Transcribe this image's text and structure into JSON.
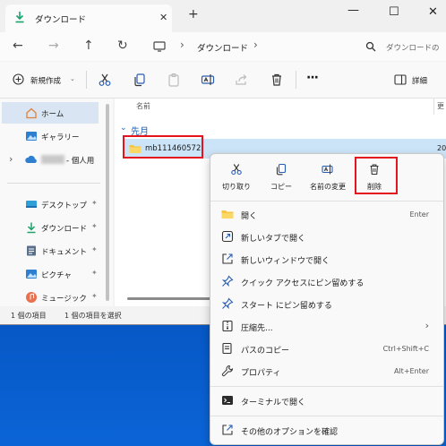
{
  "window": {
    "tab_title": "ダウンロード",
    "tab_close": "✕",
    "new_tab": "+",
    "minimize": "—",
    "maximize": "☐",
    "close": "✕"
  },
  "nav": {
    "back": "←",
    "forward": "→",
    "up": "↑",
    "refresh": "↻",
    "separator": "›",
    "breadcrumb": "ダウンロード",
    "search_placeholder": "ダウンロードの"
  },
  "toolbar": {
    "new_label": "新規作成",
    "details_label": "詳細",
    "more": "···"
  },
  "sidebar": {
    "items": [
      {
        "label": "ホーム",
        "icon": "home-icon"
      },
      {
        "label": "ギャラリー",
        "icon": "gallery-icon"
      },
      {
        "label": "- 個人用",
        "icon": "onedrive-icon"
      },
      {
        "label": "デスクトップ",
        "icon": "desktop-folder-icon"
      },
      {
        "label": "ダウンロード",
        "icon": "download-icon"
      },
      {
        "label": "ドキュメント",
        "icon": "documents-icon"
      },
      {
        "label": "ピクチャ",
        "icon": "pictures-icon"
      },
      {
        "label": "ミュージック",
        "icon": "music-icon"
      }
    ],
    "pin": "📌",
    "expander": "›"
  },
  "content": {
    "column_name": "名前",
    "column_date_partial": "更",
    "group_label": "先月",
    "file_name": "mb111460572",
    "file_date_partial": "20"
  },
  "status": {
    "count": "1 個の項目",
    "selected": "1 個の項目を選択"
  },
  "context_menu": {
    "quick_actions": [
      {
        "label": "切り取り",
        "icon": "scissors-icon"
      },
      {
        "label": "コピー",
        "icon": "copy-icon"
      },
      {
        "label": "名前の変更",
        "icon": "rename-icon"
      },
      {
        "label": "削除",
        "icon": "trash-icon"
      }
    ],
    "items": [
      {
        "label": "開く",
        "key": "Enter",
        "icon": "folder-open-icon"
      },
      {
        "label": "新しいタブで開く",
        "key": "",
        "icon": "new-tab-icon"
      },
      {
        "label": "新しいウィンドウで開く",
        "key": "",
        "icon": "new-window-icon"
      },
      {
        "label": "クイック アクセスにピン留めする",
        "key": "",
        "icon": "pin-icon"
      },
      {
        "label": "スタート にピン留めする",
        "key": "",
        "icon": "pin-start-icon"
      },
      {
        "label": "圧縮先...",
        "key": "›",
        "icon": "zip-icon"
      },
      {
        "label": "パスのコピー",
        "key": "Ctrl+Shift+C",
        "icon": "copy-path-icon"
      },
      {
        "label": "プロパティ",
        "key": "Alt+Enter",
        "icon": "wrench-icon"
      },
      {
        "label": "ターミナルで開く",
        "key": "",
        "icon": "terminal-icon"
      },
      {
        "label": "その他のオプションを確認",
        "key": "",
        "icon": "more-options-icon"
      }
    ]
  },
  "colors": {
    "accent": "#0067c0",
    "highlight_box": "#e3141e",
    "folder": "#f5c542",
    "selection": "#cce4f7"
  }
}
